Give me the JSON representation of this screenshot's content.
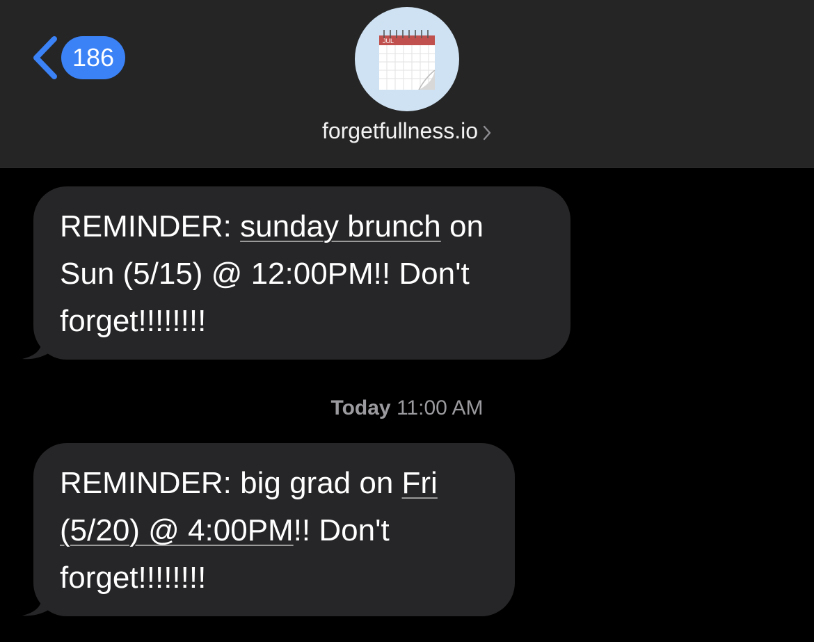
{
  "header": {
    "unread_count": "186",
    "contact_name": "forgetfullness.io",
    "avatar_icon": "calendar-icon",
    "avatar_month": "JUL",
    "accent_color": "#3b82f6"
  },
  "messages": [
    {
      "parts": {
        "prefix": "REMINDER: ",
        "link1": "sunday brunch",
        "mid": " on Sun (5/15) @ 12:00PM!! Don't forget!!!!!!!!"
      }
    },
    {
      "parts": {
        "prefix": "REMINDER: big grad on ",
        "link1": "Fri (5/20) @ 4:00PM",
        "mid": "!! Don't forget!!!!!!!!"
      }
    }
  ],
  "timestamp": {
    "day": "Today",
    "time": "11:00 AM"
  }
}
